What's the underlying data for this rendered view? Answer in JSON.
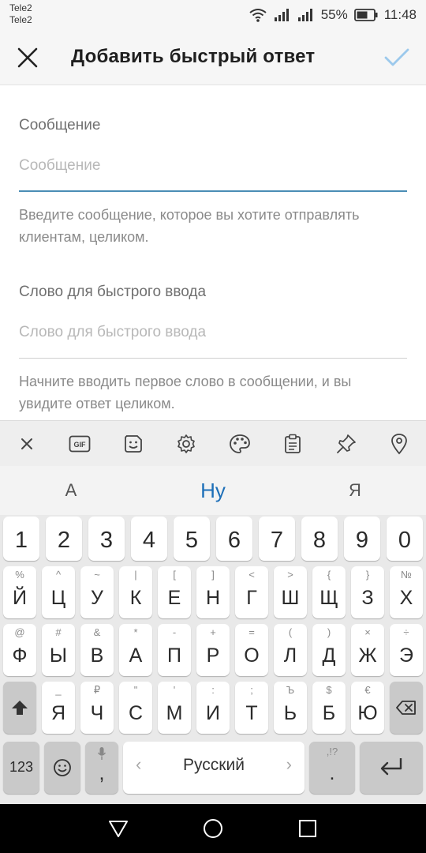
{
  "status_bar": {
    "carrier_1": "Tele2",
    "carrier_2": "Tele2",
    "battery_percent": "55%",
    "time": "11:48",
    "icons": [
      "wifi-icon",
      "signal-icon",
      "signal-icon",
      "battery-icon"
    ]
  },
  "app_bar": {
    "title": "Добавить быстрый ответ",
    "close_icon": "close-icon",
    "confirm_icon": "check-icon"
  },
  "form": {
    "message": {
      "label": "Сообщение",
      "placeholder": "Сообщение",
      "value": "",
      "helper": "Введите сообщение, которое вы хотите отправлять клиентам, целиком."
    },
    "shortcut": {
      "label": "Слово для быстрого ввода",
      "placeholder": "Слово для быстрого ввода",
      "value": "",
      "helper": "Начните вводить первое слово в сообщении, и вы увидите ответ целиком."
    }
  },
  "keyboard": {
    "toolbar": [
      "close-icon",
      "gif-icon",
      "sticker-icon",
      "settings-icon",
      "palette-icon",
      "clipboard-icon",
      "pin-icon",
      "location-icon"
    ],
    "gif_label": "GIF",
    "suggestions": [
      "А",
      "Ну",
      "Я"
    ],
    "number_row": [
      "1",
      "2",
      "3",
      "4",
      "5",
      "6",
      "7",
      "8",
      "9",
      "0"
    ],
    "row1": [
      {
        "main": "Й",
        "sub": "%"
      },
      {
        "main": "Ц",
        "sub": "^"
      },
      {
        "main": "У",
        "sub": "~"
      },
      {
        "main": "К",
        "sub": "|"
      },
      {
        "main": "Е",
        "sub": "["
      },
      {
        "main": "Н",
        "sub": "]"
      },
      {
        "main": "Г",
        "sub": "<"
      },
      {
        "main": "Ш",
        "sub": ">"
      },
      {
        "main": "Щ",
        "sub": "{"
      },
      {
        "main": "З",
        "sub": "}"
      },
      {
        "main": "Х",
        "sub": "№"
      }
    ],
    "row2": [
      {
        "main": "Ф",
        "sub": "@"
      },
      {
        "main": "Ы",
        "sub": "#"
      },
      {
        "main": "В",
        "sub": "&"
      },
      {
        "main": "А",
        "sub": "*"
      },
      {
        "main": "П",
        "sub": "-"
      },
      {
        "main": "Р",
        "sub": "+"
      },
      {
        "main": "О",
        "sub": "="
      },
      {
        "main": "Л",
        "sub": "("
      },
      {
        "main": "Д",
        "sub": ")"
      },
      {
        "main": "Ж",
        "sub": "×"
      },
      {
        "main": "Э",
        "sub": "÷"
      }
    ],
    "row3": [
      {
        "main": "Я",
        "sub": "_"
      },
      {
        "main": "Ч",
        "sub": "₽"
      },
      {
        "main": "С",
        "sub": "\""
      },
      {
        "main": "М",
        "sub": "'"
      },
      {
        "main": "И",
        "sub": ":"
      },
      {
        "main": "Т",
        "sub": ";"
      },
      {
        "main": "Ь",
        "sub": "Ъ"
      },
      {
        "main": "Б",
        "sub": "$"
      },
      {
        "main": "Ю",
        "sub": "€"
      }
    ],
    "shift_icon": "shift-icon",
    "backspace_icon": "backspace-icon",
    "numbers_label": "123",
    "emoji_icon": "emoji-icon",
    "comma_key": {
      "main": ",",
      "icon": "microphone-icon"
    },
    "space_label": "Русский",
    "period_key": {
      "main": ".",
      "sub": ",!?"
    },
    "enter_icon": "enter-icon"
  },
  "nav_bar": {
    "buttons": [
      "back-icon",
      "home-icon",
      "recents-icon"
    ]
  },
  "colors": {
    "accent": "#1d6fb8",
    "confirm_disabled": "#9cc9ec",
    "underline_active": "#4a8db5",
    "keyboard_bg": "#e9e9e9"
  }
}
